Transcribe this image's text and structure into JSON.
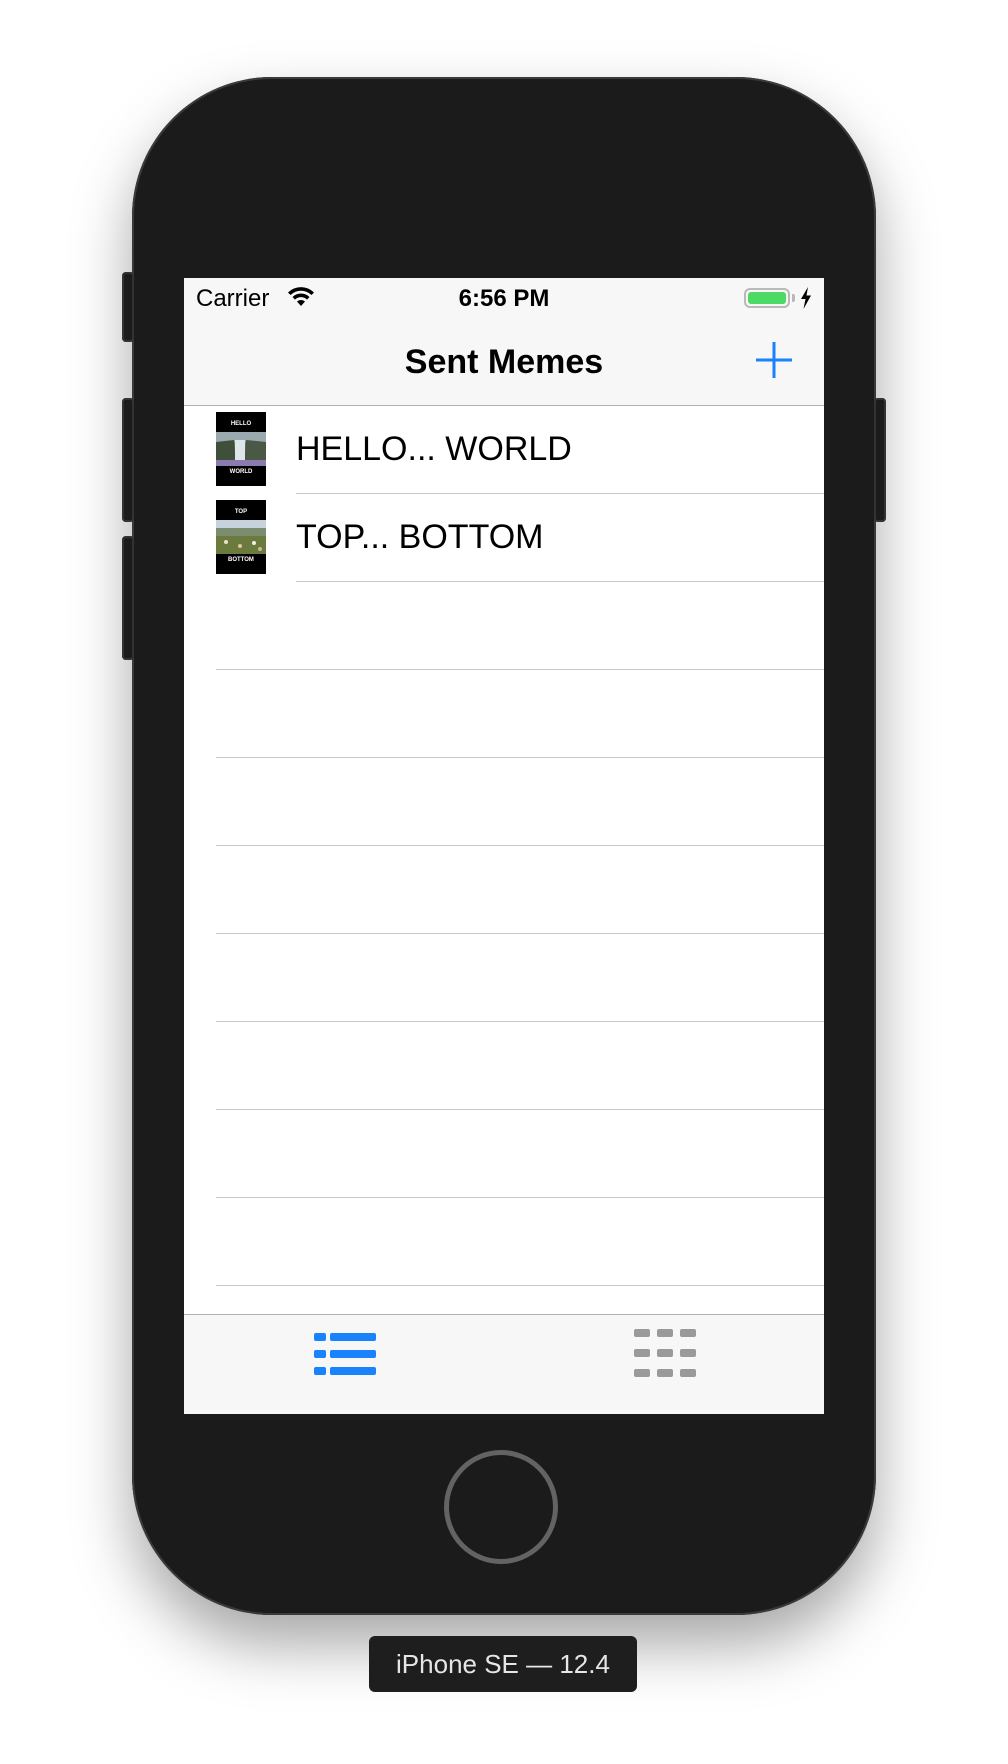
{
  "status_bar": {
    "carrier": "Carrier",
    "time": "6:56 PM",
    "battery_color": "#4cd964"
  },
  "nav": {
    "title": "Sent Memes",
    "add_icon": "plus-icon",
    "accent": "#1a82fb"
  },
  "memes": [
    {
      "label": "HELLO... WORLD",
      "top_text": "HELLO",
      "bottom_text": "WORLD"
    },
    {
      "label": "TOP... BOTTOM",
      "top_text": "TOP",
      "bottom_text": "BOTTOM"
    }
  ],
  "tabs": [
    {
      "icon": "list-icon",
      "selected": true
    },
    {
      "icon": "grid-icon",
      "selected": false
    }
  ],
  "device_label": "iPhone SE — 12.4"
}
